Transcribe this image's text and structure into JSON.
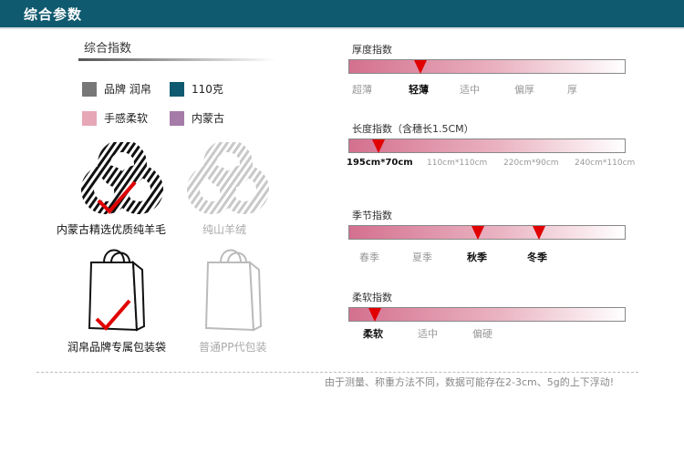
{
  "header": {
    "title": "综合参数"
  },
  "section": {
    "title": "综合指数"
  },
  "legend": [
    {
      "label": "品牌 润帛",
      "color": "#777777"
    },
    {
      "label": "110克",
      "color": "#0f5a6e"
    },
    {
      "label": "手感柔软",
      "color": "#e6a7b6"
    },
    {
      "label": "内蒙古",
      "color": "#a57ba8"
    }
  ],
  "materials": {
    "selected": "内蒙古精选优质纯羊毛",
    "other": "纯山羊绒"
  },
  "packaging": {
    "selected": "润帛品牌专属包装袋",
    "other": "普通PP代包装"
  },
  "indices": {
    "thickness": {
      "label": "厚度指数",
      "options": [
        "超薄",
        "轻薄",
        "适中",
        "偏厚",
        "厚"
      ],
      "selected": 1
    },
    "length": {
      "label": "长度指数（含穗长1.5CM）",
      "options": [
        "195cm*70cm",
        "110cm*110cm",
        "220cm*90cm",
        "240cm*110cm"
      ],
      "selected": 0
    },
    "season": {
      "label": "季节指数",
      "options": [
        "春季",
        "夏季",
        "秋季",
        "冬季"
      ],
      "selected": [
        2,
        3
      ]
    },
    "softness": {
      "label": "柔软指数",
      "options": [
        "柔软",
        "适中",
        "偏硬"
      ],
      "selected": 0
    }
  },
  "note": "由于测量、称重方法不同，数据可能存在2-3cm、5g的上下浮动!",
  "colors": {
    "header": "#0f5a6e",
    "check": "#e00000",
    "marker": "#e10000"
  }
}
